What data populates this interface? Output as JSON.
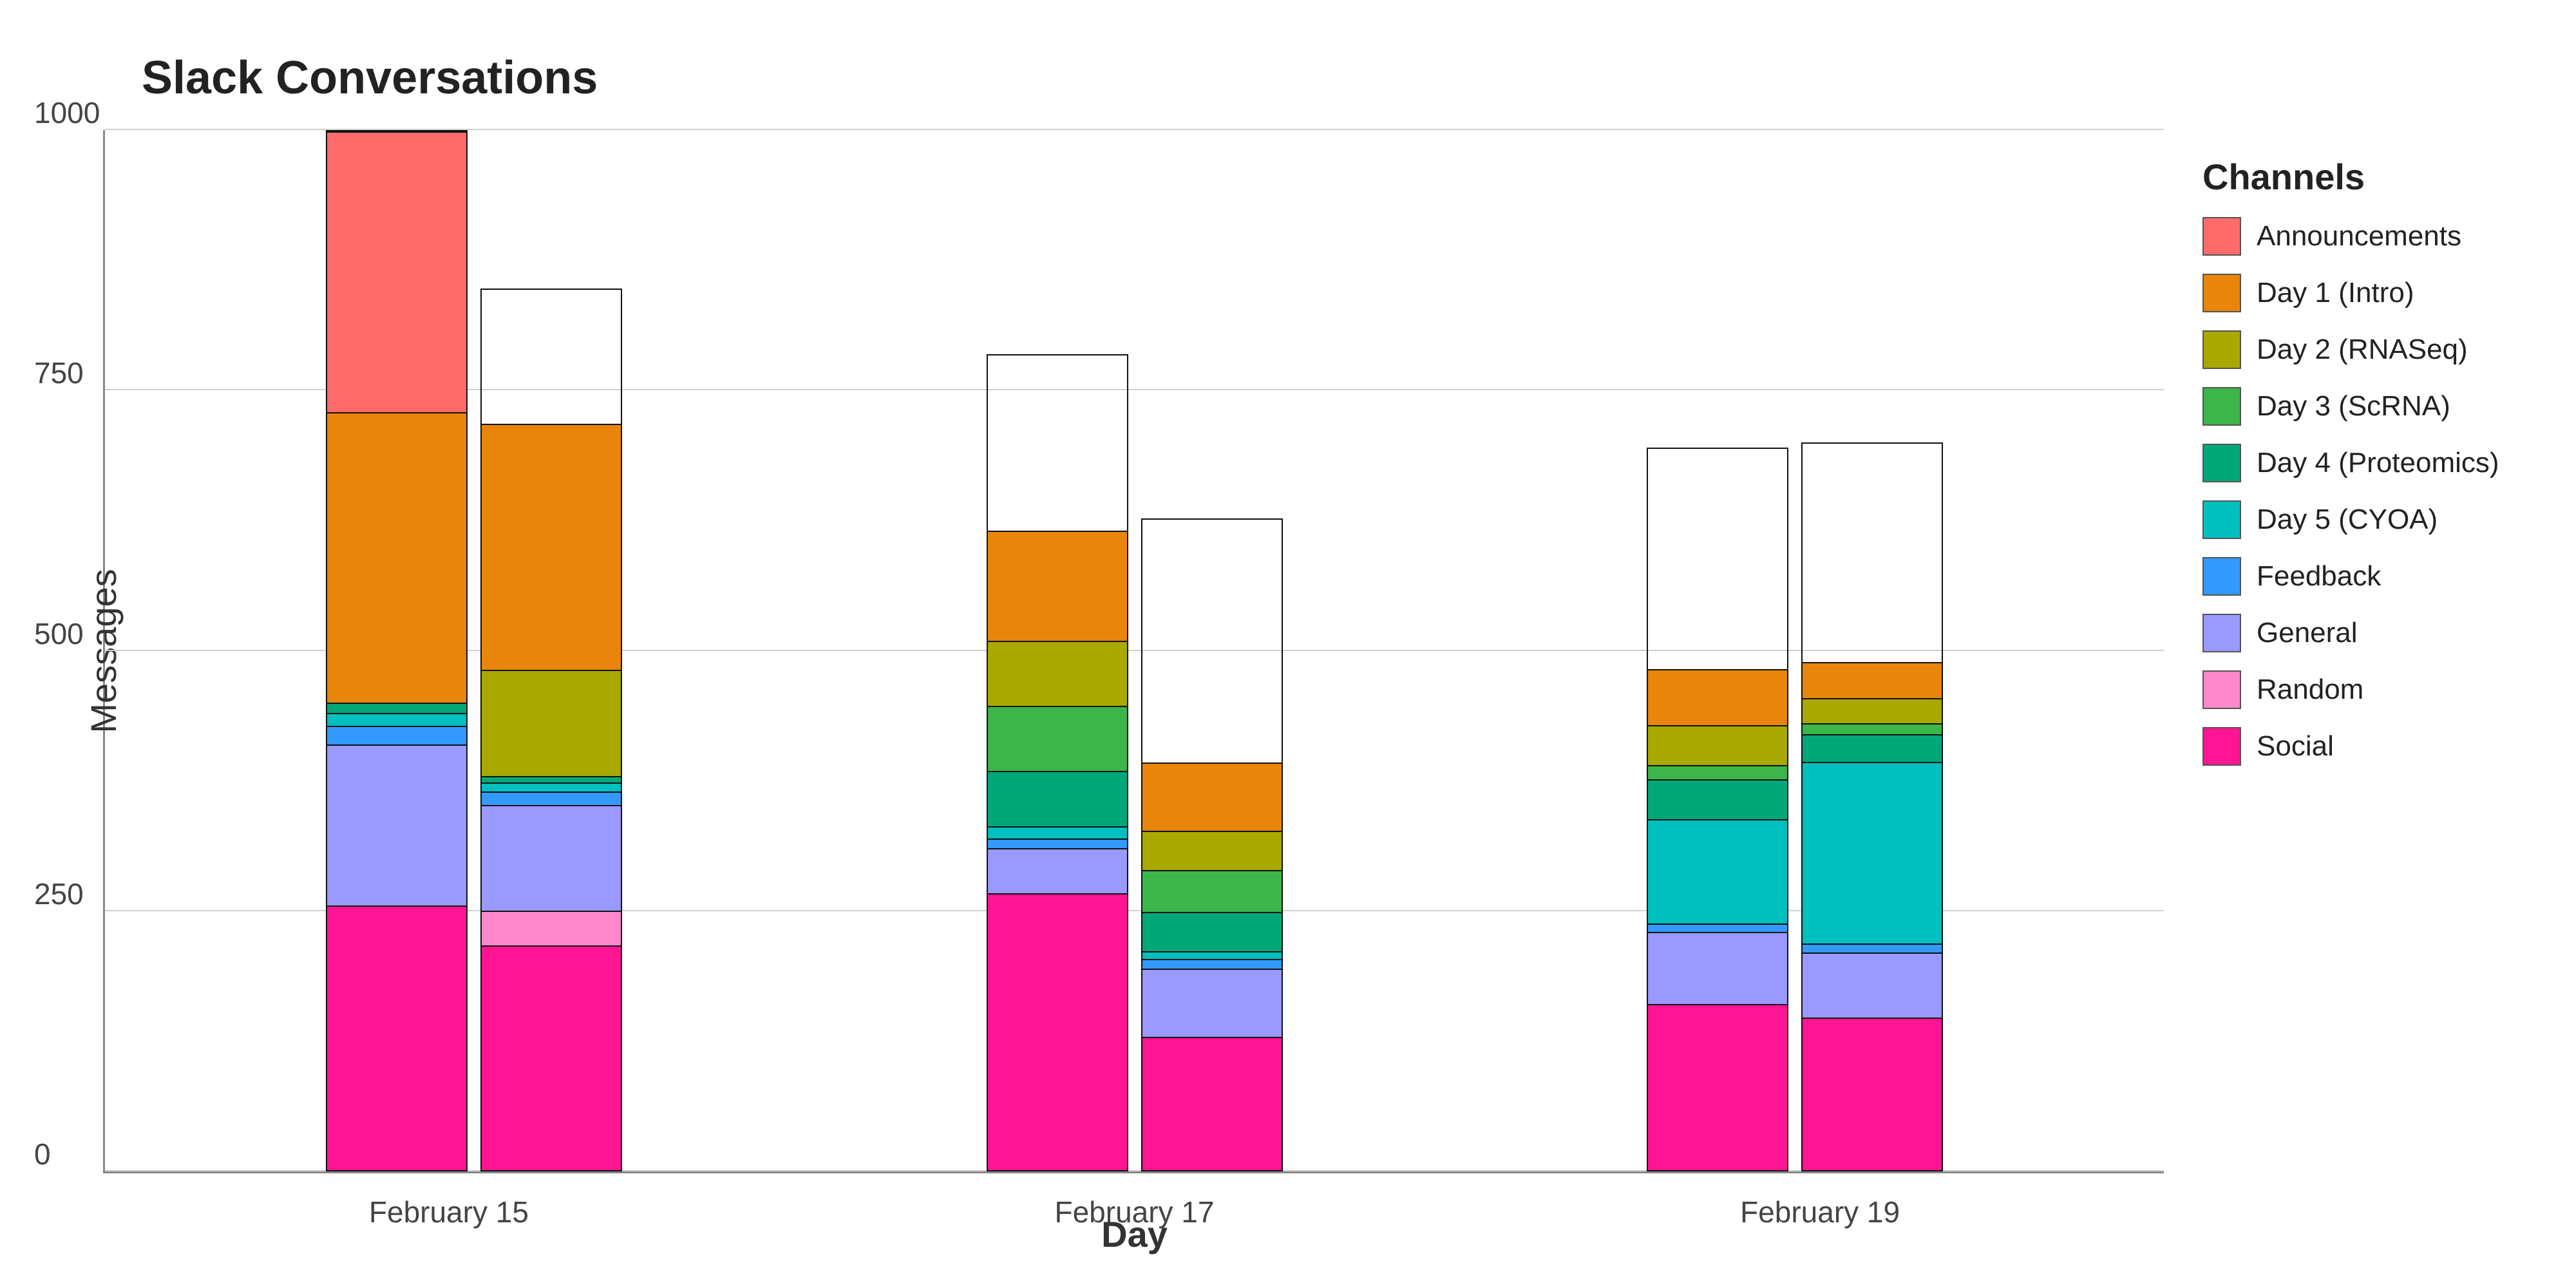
{
  "title": "Slack Conversations",
  "yAxis": {
    "label": "Messages",
    "ticks": [
      0,
      250,
      500,
      750,
      1000
    ],
    "max": 1000
  },
  "xAxis": {
    "label": "Day"
  },
  "legend": {
    "title": "Channels",
    "items": [
      {
        "name": "Announcements",
        "color": "#FF6B6B"
      },
      {
        "name": "Day 1 (Intro)",
        "color": "#E8850A"
      },
      {
        "name": "Day 2 (RNASeq)",
        "color": "#A8A800"
      },
      {
        "name": "Day 3 (ScRNA)",
        "color": "#3CB54A"
      },
      {
        "name": "Day 4 (Proteomics)",
        "color": "#00A878"
      },
      {
        "name": "Day 5 (CYOA)",
        "color": "#00BFBF"
      },
      {
        "name": "Feedback",
        "color": "#3399FF"
      },
      {
        "name": "General",
        "color": "#9999FF"
      },
      {
        "name": "Random",
        "color": "#FF88CC"
      },
      {
        "name": "Social",
        "color": "#FF1493"
      }
    ]
  },
  "groups": [
    {
      "label": "February 15",
      "labelPos": 0.167,
      "bars": [
        {
          "segments": [
            {
              "channel": "Social",
              "value": 255,
              "color": "#FF1493"
            },
            {
              "channel": "Random",
              "value": 0,
              "color": "#FF88CC"
            },
            {
              "channel": "General",
              "value": 155,
              "color": "#9999FF"
            },
            {
              "channel": "Feedback",
              "value": 18,
              "color": "#3399FF"
            },
            {
              "channel": "Day 5 (CYOA)",
              "value": 12,
              "color": "#00BFBF"
            },
            {
              "channel": "Day 4 (Proteomics)",
              "value": 10,
              "color": "#00A878"
            },
            {
              "channel": "Day 3 (ScRNA)",
              "value": 0,
              "color": "#3CB54A"
            },
            {
              "channel": "Day 2 (RNASeq)",
              "value": 0,
              "color": "#A8A800"
            },
            {
              "channel": "Day 1 (Intro)",
              "value": 280,
              "color": "#E8850A"
            },
            {
              "channel": "Announcements",
              "value": 270,
              "color": "#FF6B6B"
            }
          ],
          "total": 1000
        },
        {
          "segments": [
            {
              "channel": "Social",
              "value": 255,
              "color": "#FF1493"
            },
            {
              "channel": "Random",
              "value": 40,
              "color": "#FF88CC"
            },
            {
              "channel": "General",
              "value": 120,
              "color": "#9999FF"
            },
            {
              "channel": "Feedback",
              "value": 15,
              "color": "#3399FF"
            },
            {
              "channel": "Day 5 (CYOA)",
              "value": 10,
              "color": "#00BFBF"
            },
            {
              "channel": "Day 4 (Proteomics)",
              "value": 8,
              "color": "#00A878"
            },
            {
              "channel": "Day 3 (ScRNA)",
              "value": 0,
              "color": "#3CB54A"
            },
            {
              "channel": "Day 2 (RNASeq)",
              "value": 120,
              "color": "#A8A800"
            },
            {
              "channel": "Day 1 (Intro)",
              "value": 280,
              "color": "#E8850A"
            },
            {
              "channel": "Announcements",
              "value": 0,
              "color": "#FF6B6B"
            }
          ],
          "total": 848
        }
      ]
    },
    {
      "label": "February 17",
      "labelPos": 0.5,
      "bars": [
        {
          "segments": [
            {
              "channel": "Social",
              "value": 340,
              "color": "#FF1493"
            },
            {
              "channel": "Random",
              "value": 0,
              "color": "#FF88CC"
            },
            {
              "channel": "General",
              "value": 55,
              "color": "#9999FF"
            },
            {
              "channel": "Feedback",
              "value": 12,
              "color": "#3399FF"
            },
            {
              "channel": "Day 5 (CYOA)",
              "value": 15,
              "color": "#00BFBF"
            },
            {
              "channel": "Day 4 (Proteomics)",
              "value": 68,
              "color": "#00A878"
            },
            {
              "channel": "Day 3 (ScRNA)",
              "value": 80,
              "color": "#3CB54A"
            },
            {
              "channel": "Day 2 (RNASeq)",
              "value": 80,
              "color": "#A8A800"
            },
            {
              "channel": "Day 1 (Intro)",
              "value": 135,
              "color": "#E8850A"
            },
            {
              "channel": "Announcements",
              "value": 0,
              "color": "#FF6B6B"
            }
          ],
          "total": 785
        },
        {
          "segments": [
            {
              "channel": "Social",
              "value": 205,
              "color": "#FF1493"
            },
            {
              "channel": "Random",
              "value": 0,
              "color": "#FF88CC"
            },
            {
              "channel": "General",
              "value": 105,
              "color": "#9999FF"
            },
            {
              "channel": "Feedback",
              "value": 15,
              "color": "#3399FF"
            },
            {
              "channel": "Day 5 (CYOA)",
              "value": 12,
              "color": "#00BFBF"
            },
            {
              "channel": "Day 4 (Proteomics)",
              "value": 60,
              "color": "#00A878"
            },
            {
              "channel": "Day 3 (ScRNA)",
              "value": 65,
              "color": "#3CB54A"
            },
            {
              "channel": "Day 2 (RNASeq)",
              "value": 60,
              "color": "#A8A800"
            },
            {
              "channel": "Day 1 (Intro)",
              "value": 105,
              "color": "#E8850A"
            },
            {
              "channel": "Announcements",
              "value": 0,
              "color": "#FF6B6B"
            }
          ],
          "total": 627
        }
      ]
    },
    {
      "label": "February 19",
      "labelPos": 0.833,
      "bars": [
        {
          "segments": [
            {
              "channel": "Social",
              "value": 230,
              "color": "#FF1493"
            },
            {
              "channel": "Random",
              "value": 0,
              "color": "#FF88CC"
            },
            {
              "channel": "General",
              "value": 100,
              "color": "#9999FF"
            },
            {
              "channel": "Feedback",
              "value": 12,
              "color": "#3399FF"
            },
            {
              "channel": "Day 5 (CYOA)",
              "value": 145,
              "color": "#00BFBF"
            },
            {
              "channel": "Day 4 (Proteomics)",
              "value": 55,
              "color": "#00A878"
            },
            {
              "channel": "Day 3 (ScRNA)",
              "value": 20,
              "color": "#3CB54A"
            },
            {
              "channel": "Day 2 (RNASeq)",
              "value": 55,
              "color": "#A8A800"
            },
            {
              "channel": "Day 1 (Intro)",
              "value": 78,
              "color": "#E8850A"
            },
            {
              "channel": "Announcements",
              "value": 0,
              "color": "#FF6B6B"
            }
          ],
          "total": 695
        },
        {
          "segments": [
            {
              "channel": "Social",
              "value": 210,
              "color": "#FF1493"
            },
            {
              "channel": "Random",
              "value": 0,
              "color": "#FF88CC"
            },
            {
              "channel": "General",
              "value": 90,
              "color": "#9999FF"
            },
            {
              "channel": "Feedback",
              "value": 12,
              "color": "#3399FF"
            },
            {
              "channel": "Day 5 (CYOA)",
              "value": 250,
              "color": "#00BFBF"
            },
            {
              "channel": "Day 4 (Proteomics)",
              "value": 38,
              "color": "#00A878"
            },
            {
              "channel": "Day 3 (ScRNA)",
              "value": 15,
              "color": "#3CB54A"
            },
            {
              "channel": "Day 2 (RNASeq)",
              "value": 35,
              "color": "#A8A800"
            },
            {
              "channel": "Day 1 (Intro)",
              "value": 50,
              "color": "#E8850A"
            },
            {
              "channel": "Announcements",
              "value": 0,
              "color": "#FF6B6B"
            }
          ],
          "total": 700
        }
      ]
    }
  ]
}
